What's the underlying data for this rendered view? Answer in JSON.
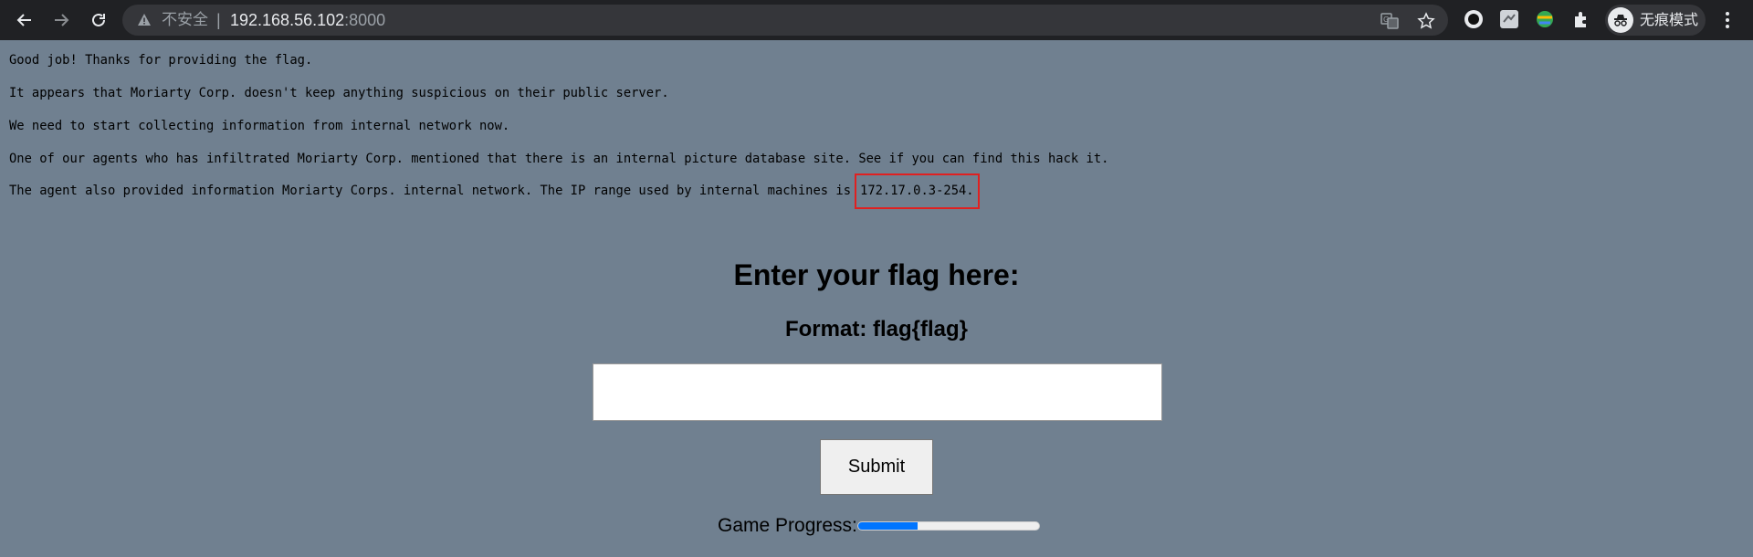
{
  "browser": {
    "security_label": "不安全",
    "separator": "|",
    "url_host": "192.168.56.102",
    "url_port": ":8000",
    "profile_label": "无痕模式",
    "icons": [
      "back-icon",
      "forward-icon",
      "reload-icon",
      "warning-icon",
      "translate-icon",
      "bookmark-star-icon",
      "extension-icon",
      "menu-icon"
    ]
  },
  "messages": [
    "Good job! Thanks for providing the flag.",
    "It appears that Moriarty Corp. doesn't keep anything suspicious on their public server.",
    "We need to start collecting information from internal network now.",
    "One of our agents who has infiltrated Moriarty Corp. mentioned that there is an internal picture database site. See if you can find this hack it.",
    "The agent also provided information Moriarty Corps. internal network. The IP range used by internal machines is"
  ],
  "ip_range": "172.17.0.3-254.",
  "form": {
    "heading": "Enter your flag here:",
    "format": "Format: flag{flag}",
    "input_value": "",
    "submit_label": "Submit"
  },
  "progress": {
    "label": "Game Progress:",
    "value": 0.33,
    "fill_color": "#0075ff"
  },
  "colors": {
    "page_background": "#708090",
    "highlight_border": "#e02020"
  }
}
